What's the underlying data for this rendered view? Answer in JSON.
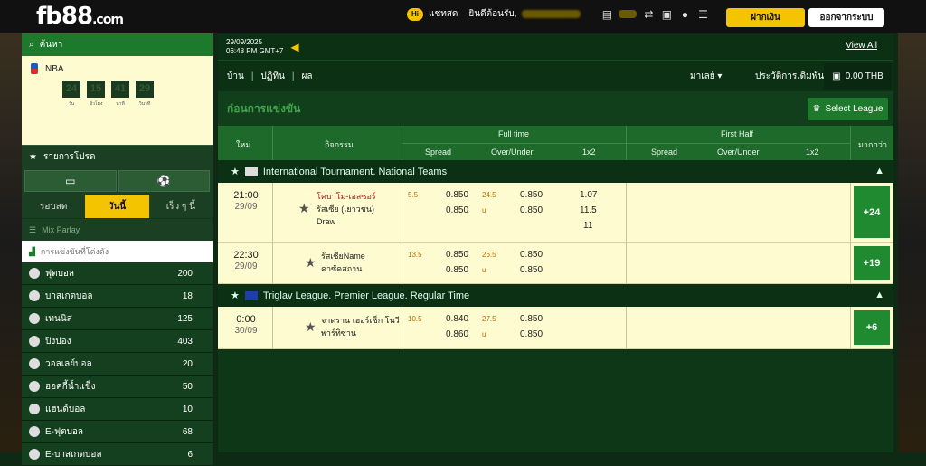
{
  "topbar": {
    "logo": "fb88",
    "logo_suffix": ".com",
    "chat_badge": "Hi",
    "chat_label": "แชทสด",
    "welcome": "ยินดีต้อนรับ,",
    "deposit": "ฝากเงิน",
    "logout": "ออกจากระบบ"
  },
  "sidebar": {
    "search_label": "ค้นหา",
    "nba_label": "NBA",
    "timer": [
      {
        "value": "24",
        "caption": "วัน"
      },
      {
        "value": "15",
        "caption": "ชั่วโมง"
      },
      {
        "value": "41",
        "caption": "นาที"
      },
      {
        "value": "29",
        "caption": "วินาที"
      }
    ],
    "favorites_label": "รายการโปรด",
    "tabs": [
      "รอบสด",
      "วันนี้",
      "เร็ว ๆ นี้"
    ],
    "active_tab": "วันนี้",
    "mix_parlay": "Mix Parlay",
    "upcoming": "การแข่งขันที่โด่งดัง",
    "sports": [
      {
        "name": "ฟุตบอล",
        "count": "200",
        "icon": "soccer-icon"
      },
      {
        "name": "บาสเกตบอล",
        "count": "18",
        "icon": "basketball-icon"
      },
      {
        "name": "เทนนิส",
        "count": "125",
        "icon": "tennis-icon"
      },
      {
        "name": "ปิงปอง",
        "count": "403",
        "icon": "pingpong-icon"
      },
      {
        "name": "วอลเลย์บอล",
        "count": "20",
        "icon": "volleyball-icon"
      },
      {
        "name": "ฮอคกี้น้ำแข็ง",
        "count": "50",
        "icon": "icehockey-icon"
      },
      {
        "name": "แฮนด์บอล",
        "count": "10",
        "icon": "handball-icon"
      },
      {
        "name": "E-ฟุตบอล",
        "count": "68",
        "icon": "esoccer-icon"
      },
      {
        "name": "E-บาสเกตบอล",
        "count": "6",
        "icon": "ebasketball-icon"
      }
    ]
  },
  "main": {
    "date": "29/09/2025",
    "time": "06:48 PM GMT+7",
    "view_all": "View All",
    "menu": [
      "บ้าน",
      "ปฏิทิน",
      "ผล"
    ],
    "odds_type": "มาเลย์",
    "bet_history": "ประวัติการเดิมพัน",
    "balance": "0.00 THB",
    "section_title": "ก่อนการแข่งขัน",
    "select_league": "Select League",
    "headers": {
      "time": "ใหม่",
      "event": "กิจกรรม",
      "fulltime": "Full time",
      "firsthalf": "First Half",
      "more": "มากกว่า",
      "spread": "Spread",
      "ou": "Over/Under",
      "x12": "1x2"
    }
  },
  "leagues": [
    {
      "name": "International Tournament. National Teams"
    },
    {
      "name": "Triglav League. Premier League. Regular Time"
    }
  ],
  "matches": [
    {
      "time": "21:00",
      "date": "29/09",
      "home": "โคบาโม-เอสซอร์",
      "away": "รัสเซีย (เยาวชน)",
      "draw": "Draw",
      "hdp": "5.5",
      "hdp_h": "0.850",
      "hdp_a": "0.850",
      "ou": "24.5",
      "ou_u": "u",
      "ou_h": "0.850",
      "ou_a": "0.850",
      "x1": "1.07",
      "x2": "11.5",
      "x3": "11",
      "more": "+24"
    },
    {
      "time": "22:30",
      "date": "29/09",
      "home": "รัสเซียName",
      "away": "คาซัคสถาน",
      "hdp": "13.5",
      "hdp_h": "0.850",
      "hdp_a": "0.850",
      "ou": "26.5",
      "ou_u": "u",
      "ou_h": "0.850",
      "ou_a": "0.850",
      "more": "+19"
    },
    {
      "time": "0:00",
      "date": "30/09",
      "home": "จาดราน เฮอร์เซ็ก โนวี",
      "away": "พาร์ทิซาน",
      "hdp": "10.5",
      "hdp_h": "0.840",
      "hdp_a": "0.860",
      "ou": "27.5",
      "ou_u": "u",
      "ou_h": "0.850",
      "ou_a": "0.850",
      "more": "+6"
    }
  ]
}
